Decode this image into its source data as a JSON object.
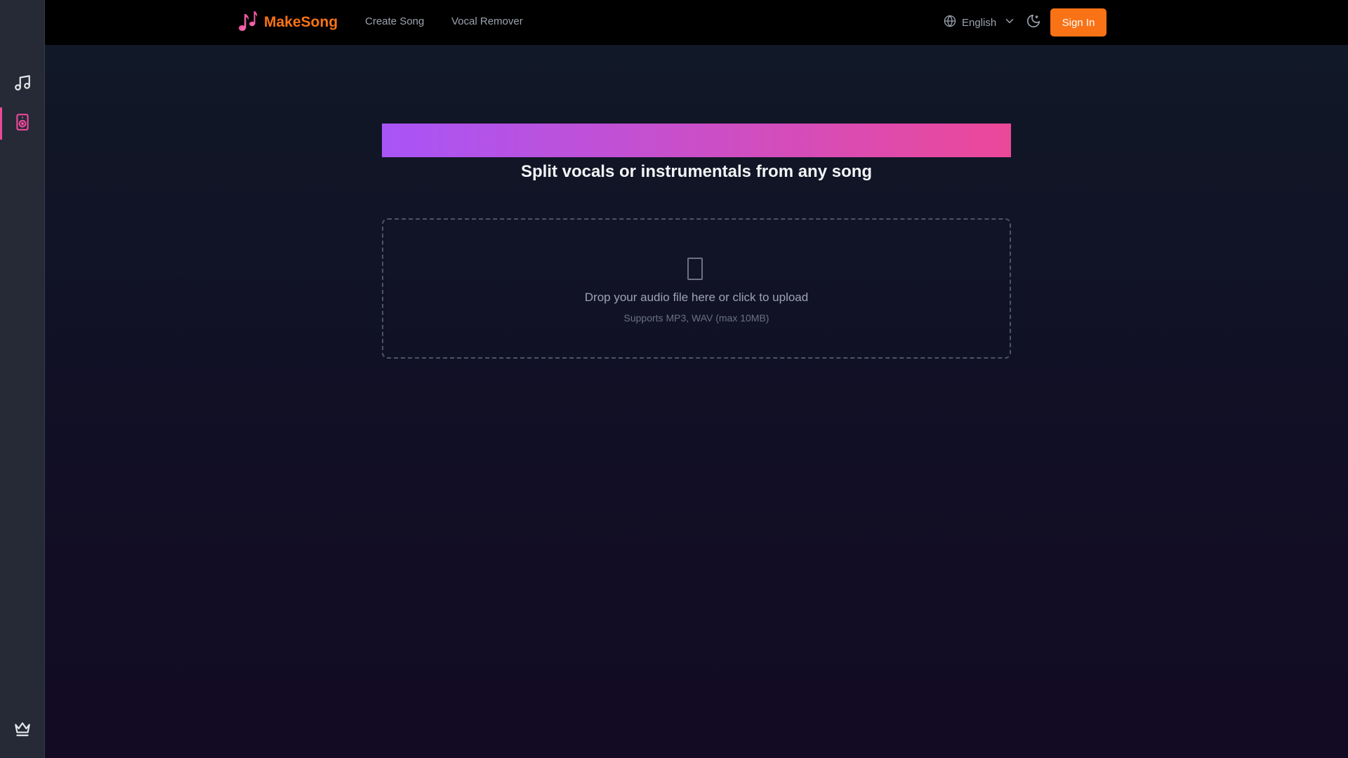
{
  "sidebar": {
    "items": [
      {
        "icon": "music-note-icon",
        "active": false
      },
      {
        "icon": "speaker-icon",
        "active": true
      }
    ],
    "bottom": {
      "icon": "crown-icon"
    }
  },
  "header": {
    "brand": "MakeSong",
    "nav": [
      {
        "label": "Create Song"
      },
      {
        "label": "Vocal Remover"
      }
    ],
    "language": "English",
    "theme_icon": "moon-icon",
    "sign_in_label": "Sign In"
  },
  "main": {
    "headline": "Split vocals or instrumentals from any song",
    "upload": {
      "icon": "file-upload-icon",
      "prompt": "Drop your audio file here or click to upload",
      "formats": "Supports MP3, WAV (max 10MB)"
    }
  },
  "colors": {
    "accent": "#f97316",
    "active_indicator": "#ec4899",
    "banner_start": "#a855f7",
    "banner_end": "#ec4899"
  }
}
